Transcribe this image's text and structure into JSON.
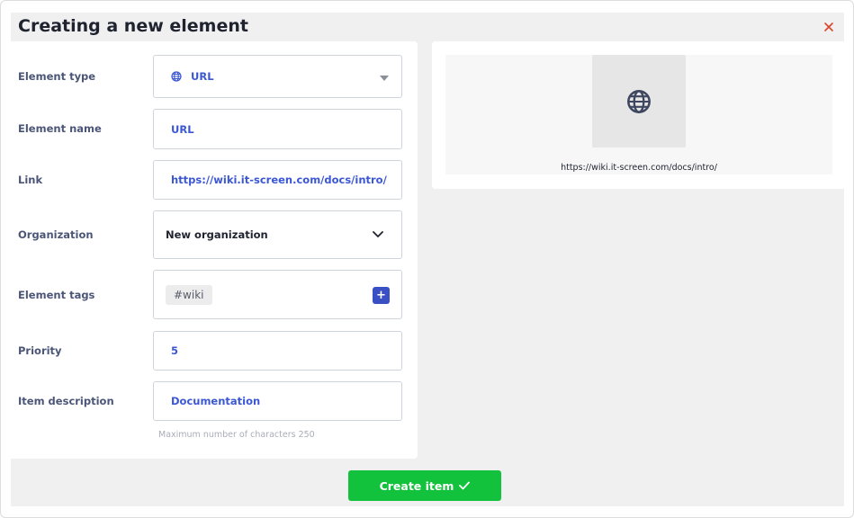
{
  "dialog": {
    "title": "Creating a new element",
    "close_label": "×"
  },
  "form": {
    "element_type": {
      "label": "Element type",
      "value": "URL",
      "icon": "globe-icon"
    },
    "element_name": {
      "label": "Element name",
      "value": "URL"
    },
    "link": {
      "label": "Link",
      "value": "https://wiki.it-screen.com/docs/intro/"
    },
    "organization": {
      "label": "Organization",
      "value": "New organization"
    },
    "element_tags": {
      "label": "Element tags",
      "tags": [
        "#wiki"
      ],
      "add_label": "+"
    },
    "priority": {
      "label": "Priority",
      "value": "5"
    },
    "item_description": {
      "label": "Item description",
      "value": "Documentation",
      "hint": "Maximum number of characters 250"
    }
  },
  "preview": {
    "icon": "globe-icon",
    "url": "https://wiki.it-screen.com/docs/intro/"
  },
  "actions": {
    "create_label": "Create item"
  },
  "colors": {
    "accent": "#3b57d4",
    "primary_button": "#12c13c",
    "close": "#d9452b"
  }
}
